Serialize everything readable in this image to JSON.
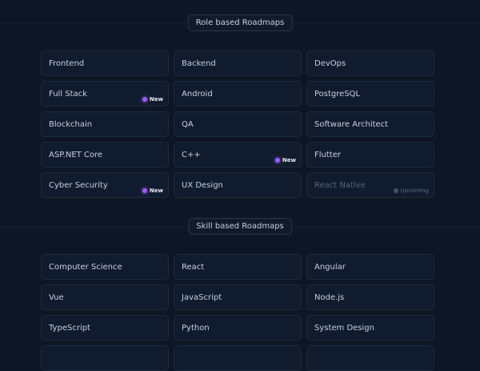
{
  "role_section": {
    "heading": "Role based Roadmaps",
    "cards": [
      {
        "label": "Frontend",
        "badge": ""
      },
      {
        "label": "Backend",
        "badge": ""
      },
      {
        "label": "DevOps",
        "badge": ""
      },
      {
        "label": "Full Stack",
        "badge": "New"
      },
      {
        "label": "Android",
        "badge": ""
      },
      {
        "label": "PostgreSQL",
        "badge": ""
      },
      {
        "label": "Blockchain",
        "badge": ""
      },
      {
        "label": "QA",
        "badge": ""
      },
      {
        "label": "Software Architect",
        "badge": ""
      },
      {
        "label": "ASP.NET Core",
        "badge": ""
      },
      {
        "label": "C++",
        "badge": "New"
      },
      {
        "label": "Flutter",
        "badge": ""
      },
      {
        "label": "Cyber Security",
        "badge": "New"
      },
      {
        "label": "UX Design",
        "badge": ""
      },
      {
        "label": "React Native",
        "badge": "Upcoming",
        "upcoming": true
      }
    ]
  },
  "skill_section": {
    "heading": "Skill based Roadmaps",
    "cards": [
      {
        "label": "Computer Science",
        "badge": ""
      },
      {
        "label": "React",
        "badge": ""
      },
      {
        "label": "Angular",
        "badge": ""
      },
      {
        "label": "Vue",
        "badge": ""
      },
      {
        "label": "JavaScript",
        "badge": ""
      },
      {
        "label": "Node.js",
        "badge": ""
      },
      {
        "label": "TypeScript",
        "badge": ""
      },
      {
        "label": "Python",
        "badge": ""
      },
      {
        "label": "System Design",
        "badge": ""
      },
      {
        "label": "",
        "badge": ""
      },
      {
        "label": "",
        "badge": ""
      },
      {
        "label": "",
        "badge": ""
      }
    ]
  },
  "colors": {
    "background": "#0e1524",
    "card": "#111b2e",
    "new_dot": "#9b5cf6"
  }
}
